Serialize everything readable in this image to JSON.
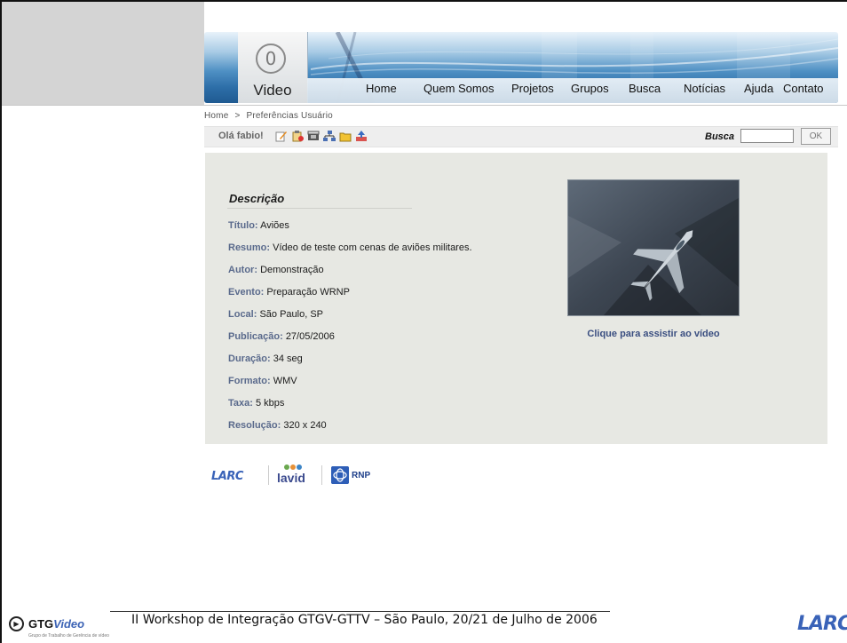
{
  "banner": {
    "logo_glyph": "0",
    "logo_word": "Video",
    "nav": [
      "Home",
      "Quem Somos",
      "Projetos",
      "Grupos",
      "Busca",
      "Notícias",
      "Ajuda",
      "Contato"
    ]
  },
  "breadcrumb": {
    "home": "Home",
    "separator": ">",
    "current": "Preferências Usuário"
  },
  "toolbar": {
    "greeting": "Olá fabio!",
    "icons": [
      "edit-icon",
      "clipboard-icon",
      "film-icon",
      "sitemap-icon",
      "folder-icon",
      "upload-icon"
    ],
    "search_label": "Busca",
    "search_value": "",
    "ok_label": "OK"
  },
  "description": {
    "heading": "Descrição",
    "fields": [
      {
        "label": "Título:",
        "value": "Aviões"
      },
      {
        "label": "Resumo:",
        "value": "Vídeo de teste com cenas de aviões militares."
      },
      {
        "label": "Autor:",
        "value": "Demonstração"
      },
      {
        "label": "Evento:",
        "value": "Preparação WRNP"
      },
      {
        "label": "Local:",
        "value": "São Paulo, SP"
      },
      {
        "label": "Publicação:",
        "value": "27/05/2006"
      },
      {
        "label": "Duração:",
        "value": "34 seg"
      },
      {
        "label": "Formato:",
        "value": "WMV"
      },
      {
        "label": "Taxa:",
        "value": "5 kbps"
      },
      {
        "label": "Resolução:",
        "value": "320 x 240"
      }
    ],
    "watch_link": "Clique para assistir ao vídeo"
  },
  "partners": {
    "larc": "LARC",
    "lavid": "lavid",
    "rnp": "RNP"
  },
  "footer": {
    "logo_word_a": "GTG",
    "logo_word_b": "Video",
    "logo_sub": "Grupo de Trabalho de Gerência de vídeo",
    "text": "II Workshop de Integração GTGV-GTTV – São Paulo, 20/21 de Julho de 2006",
    "larc": "LARC"
  },
  "colors": {
    "banner_blue": "#2d6ea8",
    "panel_bg": "#e7e8e3",
    "label_blue": "#5a6a8c",
    "link_blue": "#3a4e80",
    "larc_blue": "#3a63b8"
  }
}
